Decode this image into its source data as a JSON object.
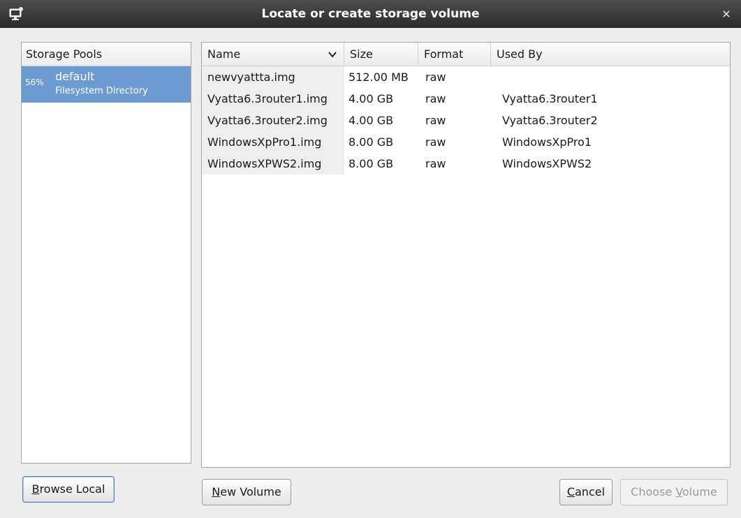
{
  "window": {
    "title": "Locate or create storage volume",
    "close_glyph": "×",
    "icon": "monitor-icon"
  },
  "pools": {
    "header": "Storage Pools",
    "items": [
      {
        "percent": "56%",
        "name": "default",
        "type": "Filesystem Directory",
        "selected": true
      }
    ]
  },
  "volumes": {
    "columns": {
      "name": "Name",
      "size": "Size",
      "format": "Format",
      "used_by": "Used By"
    },
    "rows": [
      {
        "name": "newvyattta.img",
        "size": "512.00 MB",
        "format": "raw",
        "used_by": ""
      },
      {
        "name": "Vyatta6.3router1.img",
        "size": "4.00 GB",
        "format": "raw",
        "used_by": "Vyatta6.3router1"
      },
      {
        "name": "Vyatta6.3router2.img",
        "size": "4.00 GB",
        "format": "raw",
        "used_by": "Vyatta6.3router2"
      },
      {
        "name": "WindowsXpPro1.img",
        "size": "8.00 GB",
        "format": "raw",
        "used_by": "WindowsXpPro1"
      },
      {
        "name": "WindowsXPWS2.img",
        "size": "8.00 GB",
        "format": "raw",
        "used_by": "WindowsXPWS2"
      }
    ]
  },
  "buttons": {
    "browse_local": {
      "mnemonic": "B",
      "rest": "rowse Local"
    },
    "new_volume": {
      "mnemonic": "N",
      "rest": "ew Volume"
    },
    "cancel": {
      "mnemonic": "C",
      "rest": "ancel"
    },
    "choose_volume": {
      "pre": "Choose ",
      "mnemonic": "V",
      "rest": "olume",
      "enabled": false
    }
  },
  "colors": {
    "selection": "#6b9bd0",
    "titlebar": "#3a3a3a"
  }
}
